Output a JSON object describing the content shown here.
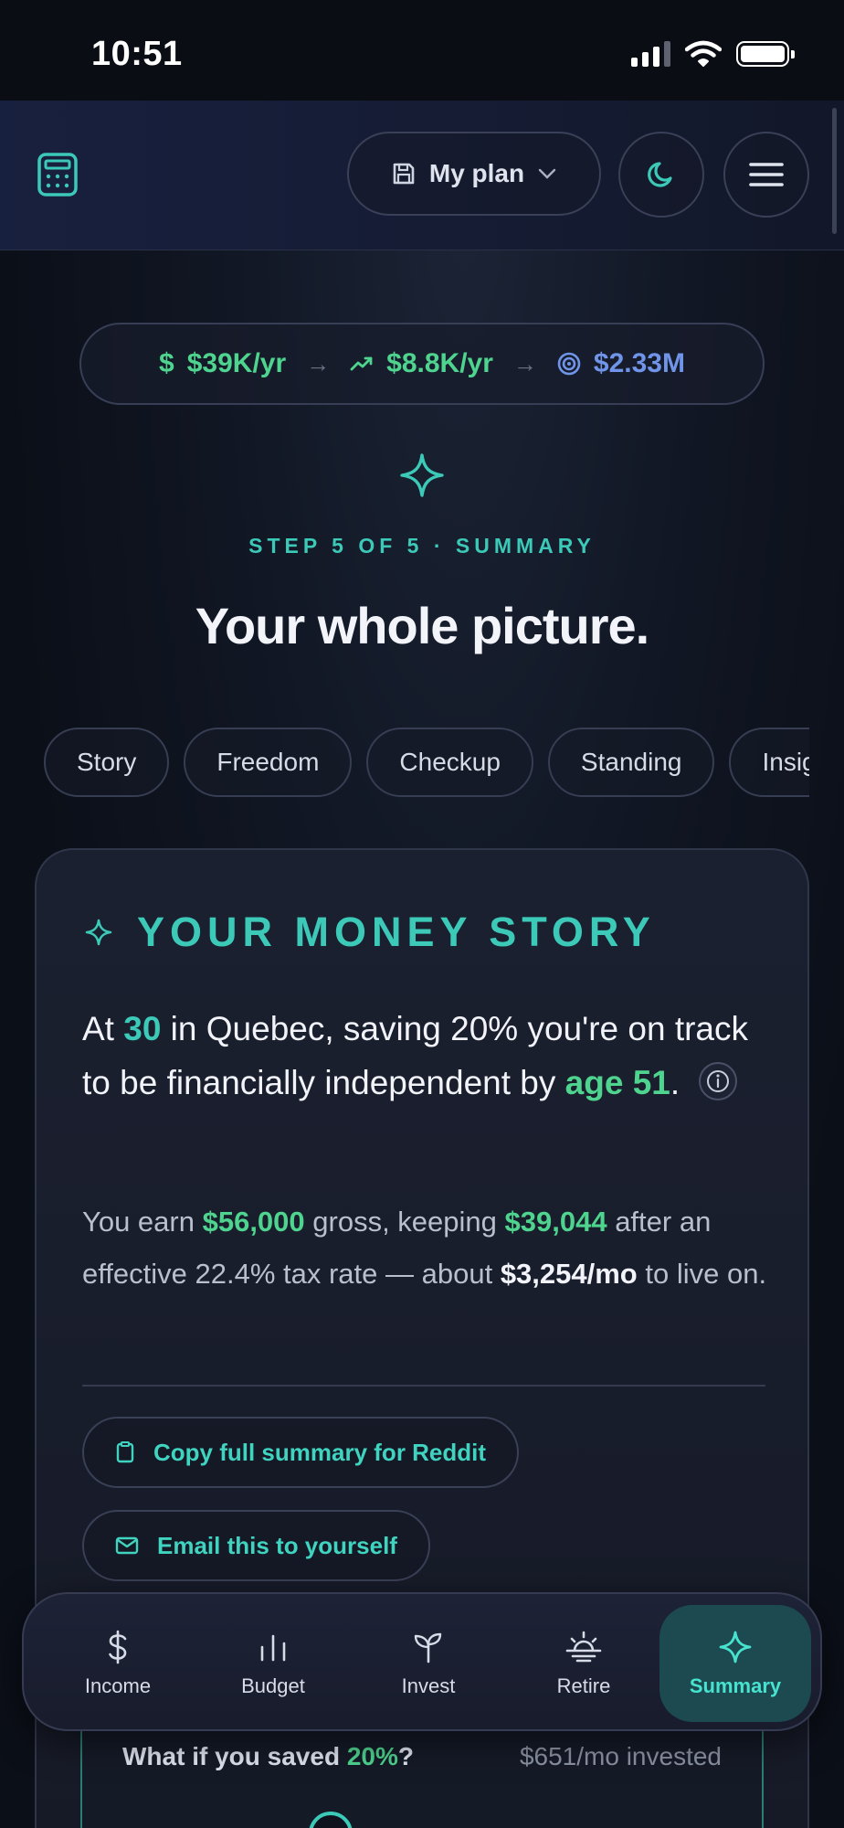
{
  "status_bar": {
    "time": "10:51"
  },
  "header": {
    "plan_label": "My plan",
    "icons": [
      "calculator-icon",
      "save-icon",
      "chevron-down-icon",
      "moon-icon",
      "menu-icon"
    ]
  },
  "summary_pill": {
    "income": "$39K/yr",
    "savings": "$8.8K/yr",
    "target": "$2.33M",
    "arrow": "→"
  },
  "step_label": "STEP 5 OF 5 · SUMMARY",
  "title": "Your whole picture.",
  "tabs": [
    {
      "label": "Story"
    },
    {
      "label": "Freedom"
    },
    {
      "label": "Checkup"
    },
    {
      "label": "Standing"
    },
    {
      "label": "Insights"
    }
  ],
  "story": {
    "heading": "YOUR MONEY STORY",
    "lead": {
      "p1": "At ",
      "age": "30",
      "p2": " in Quebec, saving 20% you're on track to be financially independent by ",
      "fi_age": "age 51",
      "p3": "."
    },
    "body": {
      "p1": "You earn ",
      "gross": "$56,000",
      "p2": " gross, keeping ",
      "net": "$39,044",
      "p3": " after an effective 22.4% tax rate — about ",
      "monthly": "$3,254/mo",
      "p4": " to live on."
    },
    "copy_button": "Copy full summary for Reddit",
    "email_button": "Email this to yourself"
  },
  "whatif": {
    "q_prefix": "What if you saved ",
    "q_rate": "20%",
    "q_suffix": "?",
    "value": "$651/mo invested"
  },
  "bottom_nav": [
    {
      "label": "Income",
      "icon": "dollar-icon"
    },
    {
      "label": "Budget",
      "icon": "bar-chart-icon"
    },
    {
      "label": "Invest",
      "icon": "sprout-icon"
    },
    {
      "label": "Retire",
      "icon": "sunset-icon"
    },
    {
      "label": "Summary",
      "icon": "sparkle-icon",
      "active": true
    }
  ],
  "colors": {
    "accent_teal": "#3cc9b8",
    "accent_green": "#4ed48e",
    "accent_blue": "#6f94e8",
    "background": "#0b0f1a"
  }
}
